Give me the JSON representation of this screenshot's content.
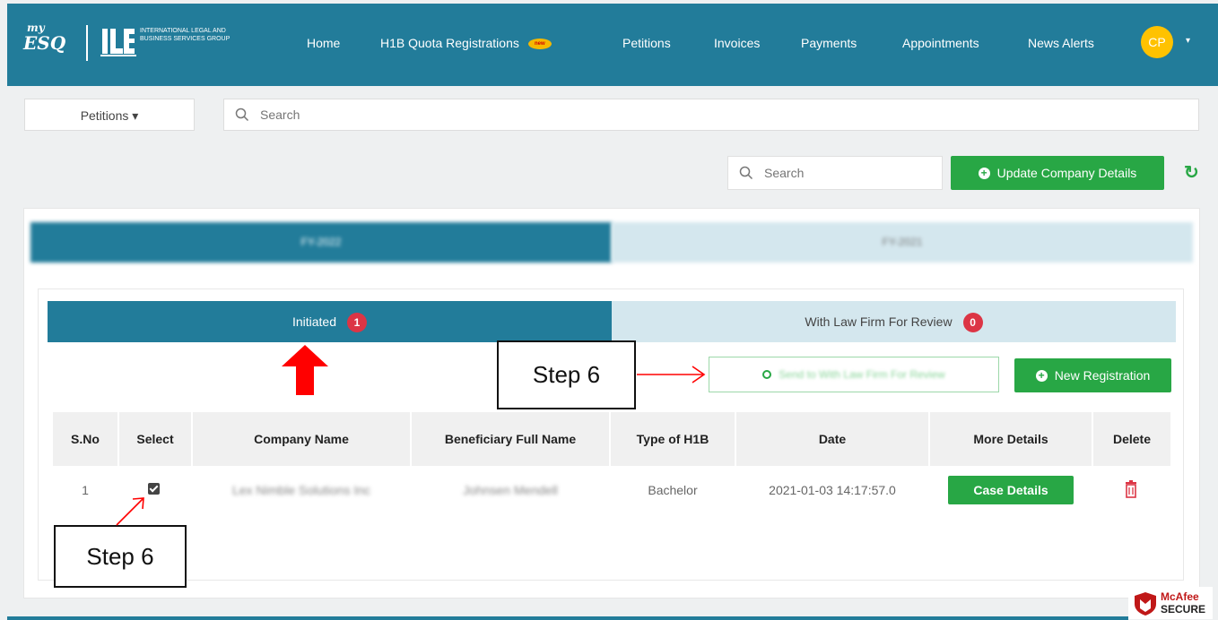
{
  "brand": {
    "logo_my": "my",
    "logo_esq": "ESQ",
    "org_name": "International Legal and Business Services Group"
  },
  "nav": {
    "items": [
      "Home",
      "H1B Quota Registrations",
      "Petitions",
      "Invoices",
      "Payments",
      "Appointments",
      "News Alerts"
    ],
    "new_badge": "new",
    "user_initials": "CP",
    "user_caret": "▾"
  },
  "subbar": {
    "dropdown_label": "Petitions ▾",
    "search_placeholder": "Search"
  },
  "toolbar": {
    "search_placeholder": "Search",
    "update_button": "Update Company Details",
    "refresh_icon": "↻"
  },
  "fiscal_tabs": [
    "FY-2022",
    "FY-2021"
  ],
  "status_tabs": [
    {
      "label": "Initiated",
      "count": "1"
    },
    {
      "label": "With Law Firm For Review",
      "count": "0"
    }
  ],
  "actions": {
    "send_button": "Send to With Law Firm For Review",
    "new_registration_button": "New Registration"
  },
  "table": {
    "headers": [
      "S.No",
      "Select",
      "Company Name",
      "Beneficiary Full Name",
      "Type of H1B",
      "Date",
      "More Details",
      "Delete"
    ],
    "rows": [
      {
        "sno": "1",
        "selected": true,
        "company": "Lex Nimble Solutions Inc",
        "beneficiary": "Johnsen Mendell",
        "type": "Bachelor",
        "date": "2021-01-03 14:17:57.0",
        "details_button": "Case Details"
      }
    ]
  },
  "annotations": {
    "step_label_top": "Step 6",
    "step_label_bottom": "Step 6"
  },
  "badge": {
    "line1": "McAfee",
    "line2": "SECURE"
  },
  "colors": {
    "header": "#227c9a",
    "accent_green": "#28a745",
    "badge_red": "#dc3545",
    "inactive_tab": "#d4e7ee",
    "avatar": "#ffc200"
  }
}
